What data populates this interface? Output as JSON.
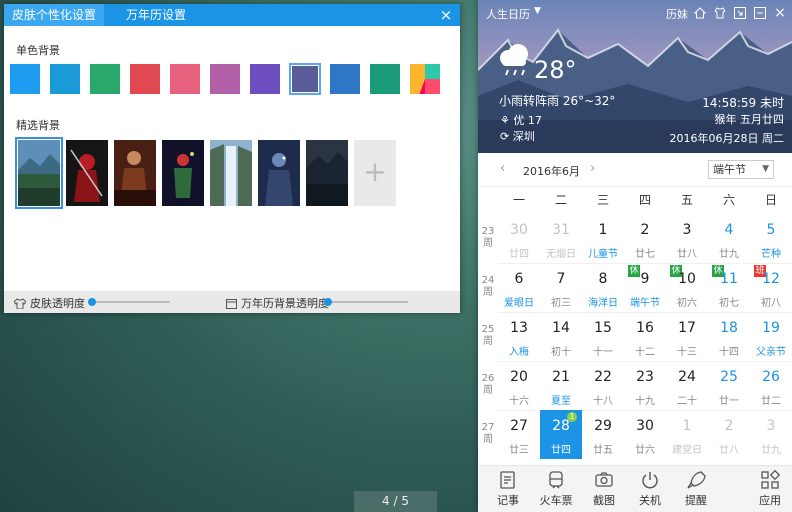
{
  "skin_window": {
    "tabs": [
      "皮肤个性化设置",
      "万年历设置"
    ],
    "close_icon": "×",
    "solid_title": "单色背景",
    "solid_colors": [
      "#1e9cf0",
      "#1a9bd8",
      "#28a86b",
      "#e04852",
      "#e8617f",
      "#b260a7",
      "#6e4fc1",
      "#5a5c98",
      "#2f77c6",
      "#1a9c78",
      "multicolor"
    ],
    "selected_solid": 7,
    "featured_title": "精选背景",
    "featured_count": 7,
    "add_symbol": "+",
    "footer": {
      "skin_opacity": "皮肤透明度",
      "calendar_opacity": "万年历背景透明度"
    }
  },
  "pager": "4 / 5",
  "calendar": {
    "app_name": "人生日历",
    "history": "历妹",
    "temp": "28°",
    "weather": "小雨转阵雨 26°~32°",
    "aqi": "优 17",
    "city": "深圳",
    "time": "14:58:59 未时",
    "lunar": "猴年 五月廿四",
    "date": "2016年06月28日 周二",
    "month": "2016年6月",
    "festival": "端午节",
    "weekdays": [
      "一",
      "二",
      "三",
      "四",
      "五",
      "六",
      "日"
    ],
    "week_label": "周",
    "weeks": [
      {
        "n": "23",
        "days": [
          {
            "d": "30",
            "s": "廿四",
            "t": "fade"
          },
          {
            "d": "31",
            "s": "无烟日",
            "t": "fade"
          },
          {
            "d": "1",
            "s": "儿童节",
            "sc": "blue"
          },
          {
            "d": "2",
            "s": "廿七"
          },
          {
            "d": "3",
            "s": "廿八"
          },
          {
            "d": "4",
            "s": "廿九",
            "t": "blue"
          },
          {
            "d": "5",
            "s": "芒种",
            "t": "blue",
            "sc": "blue"
          }
        ]
      },
      {
        "n": "24",
        "days": [
          {
            "d": "6",
            "s": "爱眼日",
            "sc": "blue"
          },
          {
            "d": "7",
            "s": "初三"
          },
          {
            "d": "8",
            "s": "海洋日",
            "sc": "blue"
          },
          {
            "d": "9",
            "s": "端午节",
            "b": "休",
            "bt": "rest",
            "sc": "blue"
          },
          {
            "d": "10",
            "s": "初六",
            "b": "休",
            "bt": "rest"
          },
          {
            "d": "11",
            "s": "初七",
            "b": "休",
            "bt": "rest",
            "t": "blue"
          },
          {
            "d": "12",
            "s": "初八",
            "b": "班",
            "bt": "work",
            "t": "blue"
          }
        ]
      },
      {
        "n": "25",
        "days": [
          {
            "d": "13",
            "s": "入梅",
            "sc": "blue"
          },
          {
            "d": "14",
            "s": "初十"
          },
          {
            "d": "15",
            "s": "十一"
          },
          {
            "d": "16",
            "s": "十二"
          },
          {
            "d": "17",
            "s": "十三"
          },
          {
            "d": "18",
            "s": "十四",
            "t": "blue"
          },
          {
            "d": "19",
            "s": "父亲节",
            "t": "blue",
            "sc": "blue"
          }
        ]
      },
      {
        "n": "26",
        "days": [
          {
            "d": "20",
            "s": "十六"
          },
          {
            "d": "21",
            "s": "夏至",
            "sc": "blue"
          },
          {
            "d": "22",
            "s": "十八"
          },
          {
            "d": "23",
            "s": "十九"
          },
          {
            "d": "24",
            "s": "二十"
          },
          {
            "d": "25",
            "s": "廿一",
            "t": "blue"
          },
          {
            "d": "26",
            "s": "廿二",
            "t": "blue"
          }
        ]
      },
      {
        "n": "27",
        "days": [
          {
            "d": "27",
            "s": "廿三"
          },
          {
            "d": "28",
            "s": "廿四",
            "t": "today",
            "note": "1"
          },
          {
            "d": "29",
            "s": "廿五"
          },
          {
            "d": "30",
            "s": "廿六"
          },
          {
            "d": "1",
            "s": "建党日",
            "t": "fade"
          },
          {
            "d": "2",
            "s": "廿八",
            "t": "fade"
          },
          {
            "d": "3",
            "s": "廿九",
            "t": "fade"
          }
        ]
      }
    ],
    "toolbar": [
      "记事",
      "火车票",
      "截图",
      "关机",
      "提醒",
      "应用"
    ]
  }
}
